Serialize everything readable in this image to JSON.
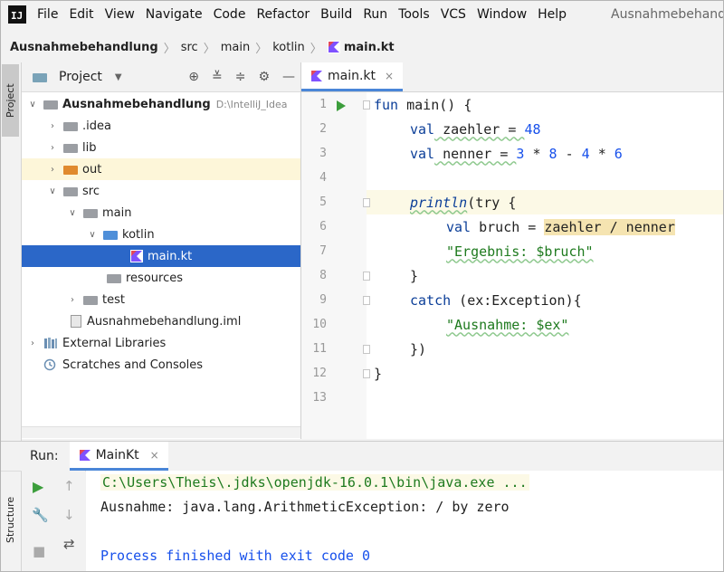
{
  "menubar": {
    "logo": "IJ",
    "items": [
      "File",
      "Edit",
      "View",
      "Navigate",
      "Code",
      "Refactor",
      "Build",
      "Run",
      "Tools",
      "VCS",
      "Window",
      "Help"
    ],
    "title": "Ausnahmebehand"
  },
  "breadcrumb": [
    "Ausnahmebehandlung",
    "src",
    "main",
    "kotlin",
    "main.kt"
  ],
  "left_stripe": {
    "project": "Project",
    "structure": "Structure"
  },
  "project_panel": {
    "title": "Project",
    "root": {
      "name": "Ausnahmebehandlung",
      "path": "D:\\IntelliJ_Idea"
    },
    "items": [
      ".idea",
      "lib",
      "out",
      "src",
      "main",
      "kotlin",
      "main.kt",
      "resources",
      "test",
      "Ausnahmebehandlung.iml",
      "External Libraries",
      "Scratches and Consoles"
    ]
  },
  "editor": {
    "tab": "main.kt",
    "line_numbers": [
      "1",
      "2",
      "3",
      "4",
      "5",
      "6",
      "7",
      "8",
      "9",
      "10",
      "11",
      "12",
      "13"
    ],
    "code": {
      "l1_kw": "fun",
      "l1_rest": " main() {",
      "l2_kw": "val",
      "l2_rest": " zaehler = ",
      "l2_num": "48",
      "l3_kw": "val",
      "l3_rest": " nenner = ",
      "l3_a": "3",
      "l3_op1": " * ",
      "l3_b": "8",
      "l3_op2": " - ",
      "l3_c": "4",
      "l3_op3": " * ",
      "l3_d": "6",
      "l5_fn": "println",
      "l5_rest": "(try {",
      "l6_kw": "val",
      "l6_rest": " bruch = ",
      "l6_hl": "zaehler / nenner",
      "l7_str": "\"Ergebnis: $bruch\"",
      "l8": "}",
      "l9_kw": "catch",
      "l9_rest": " (ex:Exception){",
      "l10_str": "\"Ausnahme: $ex\"",
      "l11": "})",
      "l12": "}"
    }
  },
  "run_panel": {
    "label": "Run:",
    "tab": "MainKt",
    "console": [
      "C:\\Users\\Theis\\.jdks\\openjdk-16.0.1\\bin\\java.exe ...",
      "Ausnahme: java.lang.ArithmeticException: / by zero",
      "",
      "Process finished with exit code 0"
    ]
  }
}
